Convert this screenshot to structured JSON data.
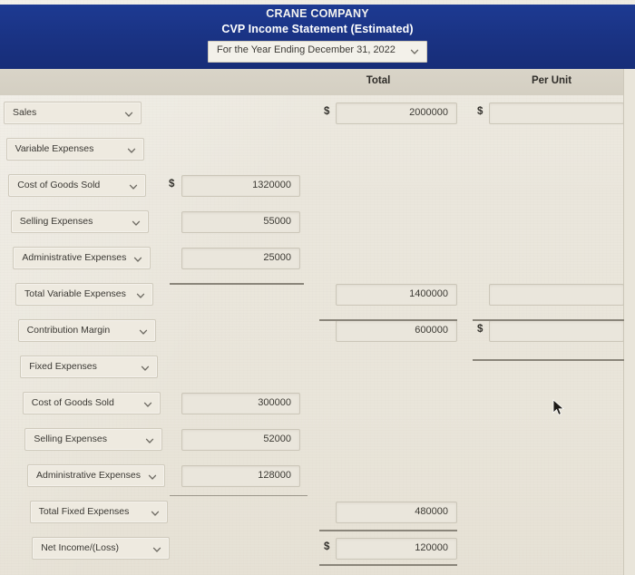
{
  "header": {
    "company": "CRANE COMPANY",
    "statement": "CVP Income Statement (Estimated)",
    "period_value": "For the Year Ending December 31, 2022",
    "caret_icon": "chevron-down-icon",
    "band_color": "#1b3485"
  },
  "columns": {
    "total_label": "Total",
    "per_unit_label": "Per Unit"
  },
  "currency_symbol": "$",
  "rows": [
    {
      "label": "Sales",
      "indent": 0,
      "mid": null,
      "total": "2000000",
      "unit": "",
      "mid_dollar": false,
      "total_dollar": true,
      "unit_dollar": true
    },
    {
      "label": "Variable Expenses",
      "indent": 1,
      "mid": null,
      "total": null,
      "unit": null,
      "mid_dollar": false,
      "total_dollar": false,
      "unit_dollar": false
    },
    {
      "label": "Cost of Goods Sold",
      "indent": 2,
      "mid": "1320000",
      "total": null,
      "unit": null,
      "mid_dollar": true,
      "total_dollar": false,
      "unit_dollar": false
    },
    {
      "label": "Selling Expenses",
      "indent": 3,
      "mid": "55000",
      "total": null,
      "unit": null,
      "mid_dollar": false,
      "total_dollar": false,
      "unit_dollar": false
    },
    {
      "label": "Administrative Expenses",
      "indent": 4,
      "mid": "25000",
      "total": null,
      "unit": null,
      "mid_dollar": false,
      "total_dollar": false,
      "unit_dollar": false
    },
    {
      "label": "Total Variable Expenses",
      "indent": 5,
      "mid": null,
      "total": "1400000",
      "unit": "",
      "mid_dollar": false,
      "total_dollar": false,
      "unit_dollar": false
    },
    {
      "label": "Contribution Margin",
      "indent": 6,
      "mid": null,
      "total": "600000",
      "unit": "",
      "mid_dollar": false,
      "total_dollar": false,
      "unit_dollar": true
    },
    {
      "label": "Fixed Expenses",
      "indent": 7,
      "mid": null,
      "total": null,
      "unit": null,
      "mid_dollar": false,
      "total_dollar": false,
      "unit_dollar": false
    },
    {
      "label": "Cost of Goods Sold",
      "indent": 8,
      "mid": "300000",
      "total": null,
      "unit": null,
      "mid_dollar": false,
      "total_dollar": false,
      "unit_dollar": false
    },
    {
      "label": "Selling Expenses",
      "indent": 9,
      "mid": "52000",
      "total": null,
      "unit": null,
      "mid_dollar": false,
      "total_dollar": false,
      "unit_dollar": false
    },
    {
      "label": "Administrative Expenses",
      "indent": 10,
      "mid": "128000",
      "total": null,
      "unit": null,
      "mid_dollar": false,
      "total_dollar": false,
      "unit_dollar": false
    },
    {
      "label": "Total Fixed Expenses",
      "indent": 11,
      "mid": null,
      "total": "480000",
      "unit": null,
      "mid_dollar": false,
      "total_dollar": false,
      "unit_dollar": false
    },
    {
      "label": "Net Income/(Loss)",
      "indent": 12,
      "mid": null,
      "total": "120000",
      "unit": null,
      "mid_dollar": false,
      "total_dollar": true,
      "unit_dollar": false
    }
  ]
}
